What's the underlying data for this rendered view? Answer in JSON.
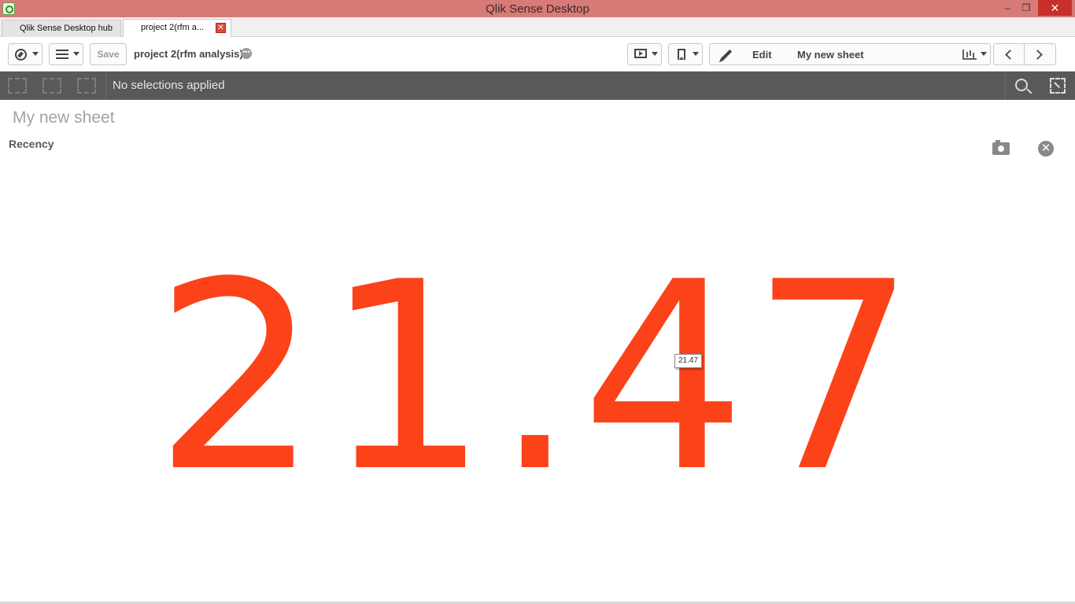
{
  "window": {
    "title": "Qlik Sense Desktop",
    "minimize_glyph": "‒",
    "maximize_glyph": "❐",
    "close_glyph": "✕"
  },
  "tabs": [
    {
      "label": "Qlik Sense Desktop hub",
      "active": false
    },
    {
      "label": "project 2(rfm a...",
      "active": true,
      "close_glyph": "✕"
    }
  ],
  "toolbar": {
    "save_label": "Save",
    "app_name": "project 2(rfm analysis)",
    "more_glyph": "•••",
    "edit_label": "Edit",
    "current_sheet": "My new sheet"
  },
  "selections": {
    "status_text": "No selections applied"
  },
  "sheet": {
    "title": "My new sheet",
    "object_title": "Recency",
    "close_glyph": "✕"
  },
  "kpi": {
    "value": "21.47",
    "tooltip": "21.47",
    "color": "#fb4219"
  },
  "colors": {
    "titlebar": "#d87a78",
    "selection_bar": "#595959"
  },
  "icons": [
    "app-logo-icon",
    "compass-icon",
    "list-icon",
    "present-icon",
    "bookmark-icon",
    "pencil-icon",
    "chart-icon",
    "chevron-left-icon",
    "chevron-right-icon",
    "back-icon",
    "forward-icon",
    "clear-selections-icon",
    "search-icon",
    "select-tool-icon",
    "camera-icon",
    "close-icon"
  ]
}
